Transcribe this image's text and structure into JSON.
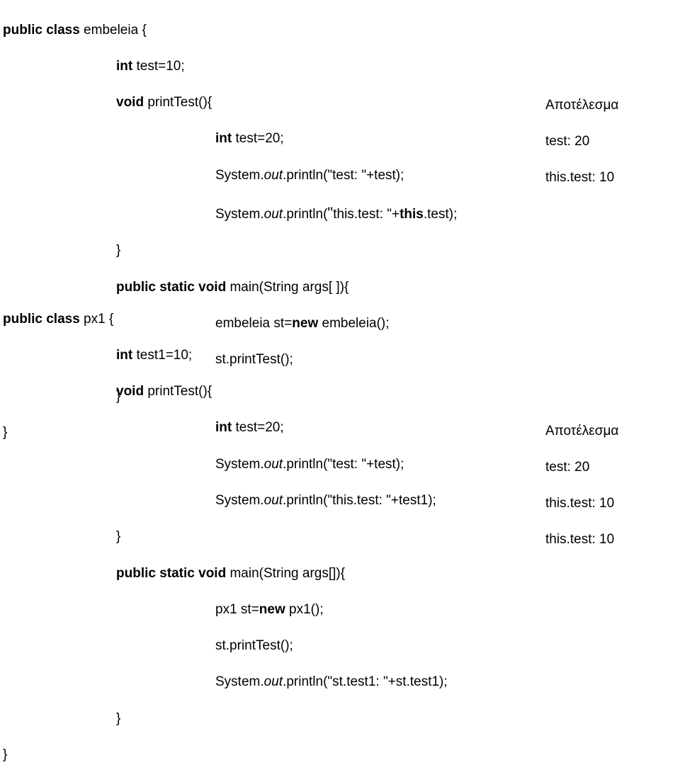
{
  "block1": {
    "l1a": "public class",
    "l1b": " embeleia {",
    "l2a": "int",
    "l2b": " test=10;",
    "l3a": "void",
    "l3b": " printTest(){",
    "l4a": "int",
    "l4b": " test=20;",
    "l5": "System.",
    "l5i": "out",
    "l5c": ".println(\"test: \"+test);",
    "l6": "System.",
    "l6i": "out",
    "l6c": ".println(",
    "l6q": "\"",
    "l6d": "this.test: \"+",
    "l6e": "this",
    "l6f": ".test);",
    "l7": "}",
    "l8a": "public static void",
    "l8b": " main(String args[ ]){",
    "l9": "embeleia st=",
    "l9a": "new",
    "l9b": " embeleia();",
    "l10": "st.printTest();",
    "l11": "}",
    "l12": "}"
  },
  "result1": {
    "title": "Αποτέλεσμα",
    "line1": "test: 20",
    "line2": "this.test: 10"
  },
  "block2": {
    "l1a": "public class",
    "l1b": " px1 {",
    "l2a": "int",
    "l2b": " test1=10;",
    "l3a": "void",
    "l3b": " printTest(){",
    "l4a": "int",
    "l4b": " test=20;",
    "l5": "System.",
    "l5i": "out",
    "l5c": ".println(\"test: \"+test);",
    "l6": "System.",
    "l6i": "out",
    "l6c": ".println(\"this.test: \"+test1);",
    "l7": "}",
    "l8a": "public static void",
    "l8b": " main(String args[]){",
    "l9": "px1 st=",
    "l9a": "new",
    "l9b": " px1();",
    "l10": "st.printTest();",
    "l11": "System.",
    "l11i": "out",
    "l11c": ".println(\"st.test1: \"+st.test1);",
    "l12": "}",
    "l13": "}"
  },
  "result2": {
    "title": "Αποτέλεσμα",
    "line1": "test: 20",
    "line2": "this.test: 10",
    "line3": "this.test: 10"
  }
}
